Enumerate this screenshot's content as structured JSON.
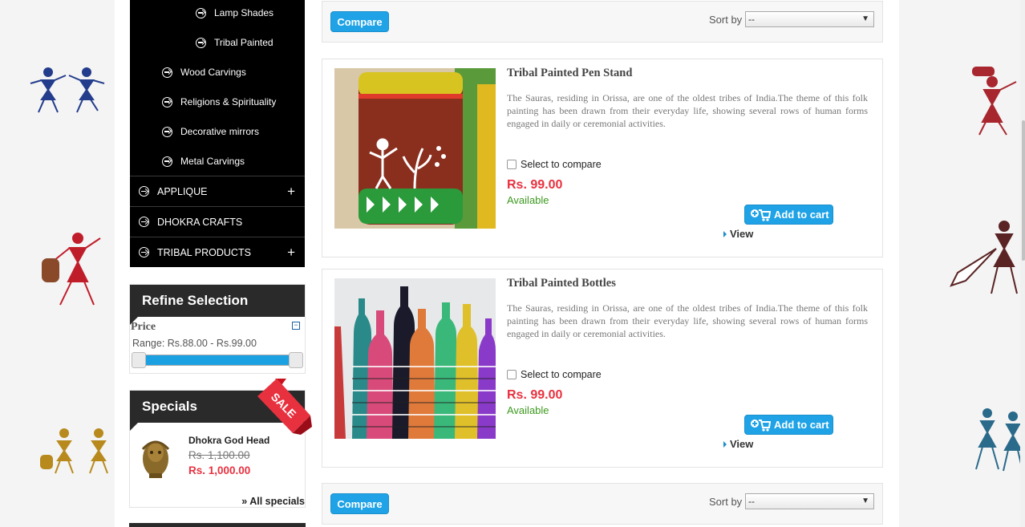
{
  "categories": {
    "sub_items": [
      {
        "label": "Lamp Shades"
      },
      {
        "label": "Tribal Painted"
      },
      {
        "label": "Wood Carvings"
      },
      {
        "label": "Religions & Spirituality"
      },
      {
        "label": "Decorative mirrors"
      },
      {
        "label": "Metal Carvings"
      }
    ],
    "top_items": [
      {
        "label": "APPLIQUE",
        "expander": "+"
      },
      {
        "label": "DHOKRA CRAFTS",
        "expander": ""
      },
      {
        "label": "TRIBAL PRODUCTS",
        "expander": "+"
      }
    ]
  },
  "refine": {
    "title": "Refine Selection",
    "price_label": "Price",
    "collapse_symbol": "−",
    "range_text": "Range: Rs.88.00 - Rs.99.00"
  },
  "specials": {
    "title": "Specials",
    "ribbon_text": "SALE",
    "item": {
      "name": "Dhokra God Head",
      "old_price": "Rs. 1,100.00",
      "new_price": "Rs. 1,000.00"
    },
    "all_link": "» All specials"
  },
  "toolbar": {
    "compare_label": "Compare",
    "sort_label": "Sort by",
    "sort_value": "--",
    "caret": "▼"
  },
  "products": [
    {
      "name": "Tribal Painted Pen Stand",
      "description": "The Sauras, residing in Orissa, are one of the oldest tribes of India.The theme of this folk painting has been drawn from their everyday life, showing several rows of human forms engaged in daily or ceremonial activities.",
      "compare_label": "Select to compare",
      "price": "Rs. 99.00",
      "availability": "Available",
      "add_to_cart": "Add to cart",
      "view": "View"
    },
    {
      "name": "Tribal Painted Bottles",
      "description": "The Sauras, residing in Orissa, are one of the oldest tribes of India.The theme of this folk painting has been drawn from their everyday life, showing several rows of human forms engaged in daily or ceremonial activities.",
      "compare_label": "Select to compare",
      "price": "Rs. 99.00",
      "availability": "Available",
      "add_to_cart": "Add to cart",
      "view": "View"
    }
  ],
  "colors": {
    "accent": "#1fa3e6",
    "price_red": "#e8313f",
    "available_green": "#3d9a1f",
    "menu_bg": "#000000"
  }
}
